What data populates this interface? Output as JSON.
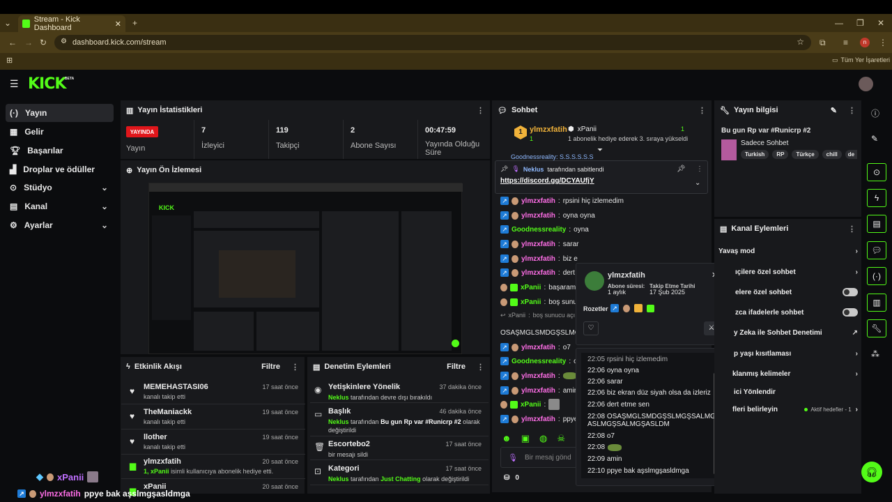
{
  "browser": {
    "tab_title": "Stream - Kick Dashboard",
    "url": "dashboard.kick.com/stream",
    "bookmarks_label": "Tüm Yer İşaretleri",
    "profile_letter": "n"
  },
  "brand": {
    "logo": "KICK",
    "beta": "BETA"
  },
  "sidebar": {
    "items": [
      {
        "label": "Yayın",
        "icon": "broadcast-icon"
      },
      {
        "label": "Gelir",
        "icon": "revenue-icon"
      },
      {
        "label": "Başarılar",
        "icon": "trophy-icon"
      },
      {
        "label": "Droplar ve ödüller",
        "icon": "gift-icon"
      },
      {
        "label": "Stüdyo",
        "icon": "studio-icon"
      },
      {
        "label": "Kanal",
        "icon": "channel-icon"
      },
      {
        "label": "Ayarlar",
        "icon": "gear-icon"
      }
    ]
  },
  "stats": {
    "title": "Yayın İstatistikleri",
    "live_badge": "YAYINDA",
    "live_label": "Yayın",
    "items": [
      {
        "value": "7",
        "label": "İzleyici"
      },
      {
        "value": "119",
        "label": "Takipçi"
      },
      {
        "value": "2",
        "label": "Abone Sayısı"
      },
      {
        "value": "00:47:59",
        "label": "Yayında Olduğu Süre"
      }
    ]
  },
  "preview": {
    "title": "Yayın Ön İzlemesi"
  },
  "activity": {
    "title": "Etkinlik Akışı",
    "filter": "Filtre",
    "items": [
      {
        "name": "MEMEHASTASI06",
        "sub": "kanalı takip etti",
        "time": "17 saat önce"
      },
      {
        "name": "TheManiackk",
        "sub": "kanalı takip etti",
        "time": "19 saat önce"
      },
      {
        "name": "llother",
        "sub": "kanalı takip etti",
        "time": "19 saat önce"
      },
      {
        "name": "ylmzxfatih",
        "sub_num": "1,",
        "sub_user": "xPanii",
        "sub_rest": "isimli kullanıcıya abonelik hediye etti.",
        "time": "20 saat önce"
      },
      {
        "name": "xPanii",
        "time": "20 saat önce"
      }
    ]
  },
  "moderation": {
    "title": "Denetim Eylemleri",
    "filter": "Filtre",
    "items": [
      {
        "title": "Yetişkinlere Yönelik",
        "actor": "Neklus",
        "text": "tarafından devre dışı bırakıldı",
        "time": "37 dakika önce"
      },
      {
        "title": "Başlık",
        "actor": "Neklus",
        "text": "tarafından",
        "value": "Bu gun Rp var #Runicrp #2",
        "text2": "olarak değiştirildi",
        "time": "46 dakika önce"
      },
      {
        "title": "Escortebo2",
        "text": "bir mesajı sildi",
        "time": "17 saat önce"
      },
      {
        "title": "Kategori",
        "actor": "Neklus",
        "text": "tarafından",
        "value": "Just Chatting",
        "text2": "olarak değiştirildi",
        "time": "17 saat önce"
      }
    ]
  },
  "chat": {
    "title": "Sohbet",
    "top_gifter": {
      "rank": "1",
      "name": "ylmzxfatih",
      "count": "1",
      "recipient": "xPanii",
      "recipient_count": "1",
      "note": "1 abonelik hediye ederek 3. sıraya yükseldi"
    },
    "partial_line": "Goodnessreality: S.S.S.S.S.S",
    "pinned": {
      "by": "Neklus",
      "text": "tarafından sabitlendi",
      "link": "https://discord.gg/DCYAUfjY"
    },
    "messages": [
      {
        "user": "ylmzxfatih",
        "text": "rpsini hiç izlemedim"
      },
      {
        "user": "ylmzxfatih",
        "text": "oyna oyna"
      },
      {
        "user": "Goodnessreality",
        "text": "oyna"
      },
      {
        "user": "ylmzxfatih",
        "text": "sarar"
      },
      {
        "user": "ylmzxfatih",
        "text": "biz e"
      },
      {
        "user": "ylmzxfatih",
        "text": "dert"
      },
      {
        "user": "xPanii",
        "text": "başarama"
      },
      {
        "user": "xPanii",
        "text": "boş sunu"
      },
      {
        "user": "xPanii",
        "text": "boş sunucu açı",
        "reply": true
      },
      {
        "user": "",
        "text": "OSAŞMGLSMDGŞSLMG"
      },
      {
        "user": "ylmzxfatih",
        "text": "o7"
      },
      {
        "user": "Goodnessreality",
        "text": "o7"
      },
      {
        "user": "ylmzxfatih",
        "text": ""
      },
      {
        "user": "ylmzxfatih",
        "text": "amir"
      },
      {
        "user": "xPanii",
        "text": ""
      },
      {
        "user": "ylmzxfatih",
        "text": "ppye"
      }
    ],
    "input_placeholder": "Bir mesaj gönd",
    "points": "0"
  },
  "user_card": {
    "name": "ylmzxfatih",
    "sub_label": "Abone süresi:",
    "sub_value": "1 aylık",
    "follow_label": "Takip Etme Tarihi",
    "follow_value": "17 Şub 2025",
    "badges_label": "Rozetler",
    "history": [
      {
        "time": "22:05",
        "text": "rpsini hiç izlemedim"
      },
      {
        "time": "22:06",
        "text": "oyna oyna"
      },
      {
        "time": "22:06",
        "text": "sarar"
      },
      {
        "time": "22:06",
        "text": "biz ekran düz siyah olsa da izleriz"
      },
      {
        "time": "22:06",
        "text": "dert etme sen"
      },
      {
        "time": "22:08",
        "text": "OSAŞMGLSMDGŞSLMGŞSALMGŞ"
      },
      {
        "time": "",
        "text": "ASLMGŞSALMGŞASLDM"
      },
      {
        "time": "22:08",
        "text": "o7"
      },
      {
        "time": "22:08",
        "text": ""
      },
      {
        "time": "22:09",
        "text": "amin"
      },
      {
        "time": "22:10",
        "text": "ppye bak aşslmgşasldmga"
      }
    ]
  },
  "stream_info": {
    "title": "Yayın bilgisi",
    "stream_title": "Bu gun Rp var #Runicrp #2",
    "category": "Sadece Sohbet",
    "tags": [
      "Turkish",
      "RP",
      "Türkçe",
      "chill",
      "de"
    ]
  },
  "channel_actions": {
    "title": "Kanal Eylemleri",
    "items": [
      {
        "label": "Yavaş mod",
        "control": "chevron"
      },
      {
        "label": "ıçilere özel sohbet",
        "control": "chevron"
      },
      {
        "label": "elere özel sohbet",
        "control": "toggle"
      },
      {
        "label": "zca ifadelerle sohbet",
        "control": "toggle"
      },
      {
        "label": "y Zeka ile Sohbet Denetimi",
        "control": "external"
      },
      {
        "label": "p yaşı kısıtlaması",
        "control": "chevron"
      },
      {
        "label": "klanmış kelimeler",
        "control": "chevron"
      },
      {
        "label": "ici Yönlendir",
        "control": "none"
      },
      {
        "label": "fleri belirleyin",
        "control": "chevron",
        "extra": "Aktif hedefler - 1"
      }
    ]
  },
  "overlay": {
    "line1_user": "xPanii",
    "line2_user": "ylmzxfatih",
    "line2_text": "ppye bak aşslmgşasldmga"
  },
  "colors": {
    "accent": "#53fc18",
    "live": "#e0161b",
    "panel": "#18191c",
    "chrome": "#3a2f12"
  }
}
